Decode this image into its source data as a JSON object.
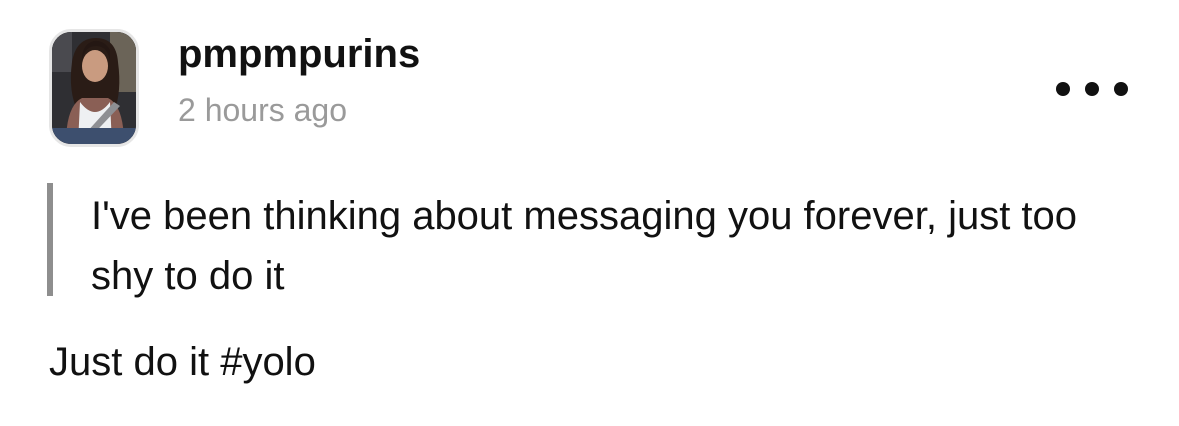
{
  "post": {
    "username": "pmpmpurins",
    "timestamp": "2 hours ago",
    "quote": "I've been thinking about messaging you forever, just too shy to do it",
    "reply": "Just do it #yolo",
    "more_icon": "more-horizontal-icon",
    "avatar_icon": "avatar-photo"
  }
}
